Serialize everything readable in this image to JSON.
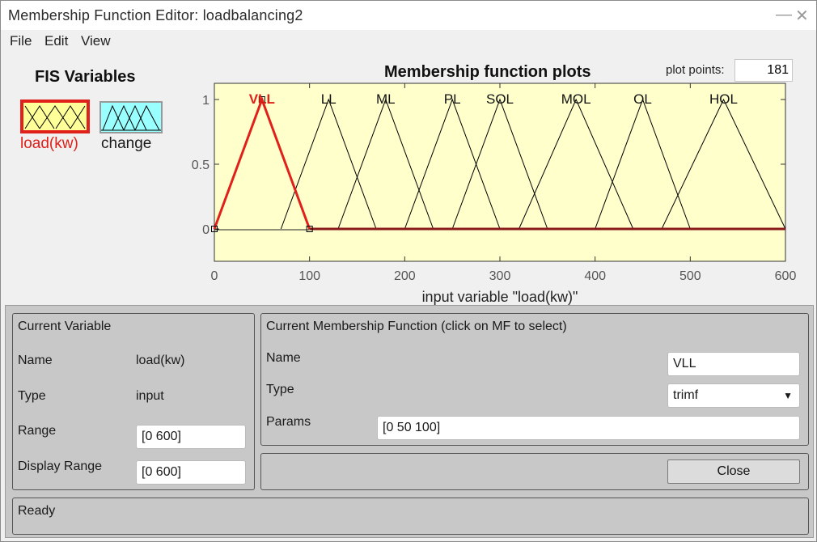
{
  "window": {
    "title": "Membership Function Editor: loadbalancing2",
    "minimize_glyph": "—",
    "close_glyph": "✕"
  },
  "menu": {
    "items": [
      "File",
      "Edit",
      "View"
    ]
  },
  "fis": {
    "heading": "FIS Variables",
    "variables": [
      {
        "label": "load(kw)",
        "selected": true
      },
      {
        "label": "change",
        "selected": false
      }
    ]
  },
  "plot": {
    "title": "Membership function plots",
    "plot_points_label": "plot points:",
    "plot_points_value": "181",
    "xlabel": "input variable \"load(kw)\"",
    "xlim": [
      0,
      600
    ],
    "ylim": [
      0,
      1
    ],
    "x_ticks": [
      "0",
      "100",
      "200",
      "300",
      "400",
      "500",
      "600"
    ],
    "y_ticks": [
      "0",
      "0.5",
      "1"
    ],
    "colors": {
      "background": "#ffffcc",
      "line": "#000000",
      "selected": "#e0201a"
    }
  },
  "chart_data": {
    "type": "line",
    "title": "Membership function plots",
    "xlabel": "input variable \"load(kw)\"",
    "ylabel": "",
    "xlim": [
      0,
      600
    ],
    "ylim": [
      0,
      1
    ],
    "series": [
      {
        "name": "VLL",
        "params": [
          0,
          50,
          100
        ],
        "selected": true
      },
      {
        "name": "LL",
        "params": [
          70,
          120,
          170
        ]
      },
      {
        "name": "ML",
        "params": [
          130,
          180,
          230
        ]
      },
      {
        "name": "PL",
        "params": [
          200,
          250,
          300
        ]
      },
      {
        "name": "SOL",
        "params": [
          250,
          300,
          350
        ]
      },
      {
        "name": "MOL",
        "params": [
          320,
          380,
          440
        ]
      },
      {
        "name": "OL",
        "params": [
          400,
          450,
          500
        ]
      },
      {
        "name": "HOL",
        "params": [
          470,
          535,
          600
        ]
      }
    ]
  },
  "current_variable": {
    "heading": "Current Variable",
    "name_label": "Name",
    "name_value": "load(kw)",
    "type_label": "Type",
    "type_value": "input",
    "range_label": "Range",
    "range_value": "[0 600]",
    "display_range_label": "Display Range",
    "display_range_value": "[0 600]"
  },
  "current_mf": {
    "heading": "Current Membership Function (click on MF to select)",
    "name_label": "Name",
    "name_value": "VLL",
    "type_label": "Type",
    "type_value": "trimf",
    "params_label": "Params",
    "params_value": "[0 50 100]"
  },
  "buttons": {
    "close_label": "Close"
  },
  "status": {
    "text": "Ready"
  }
}
